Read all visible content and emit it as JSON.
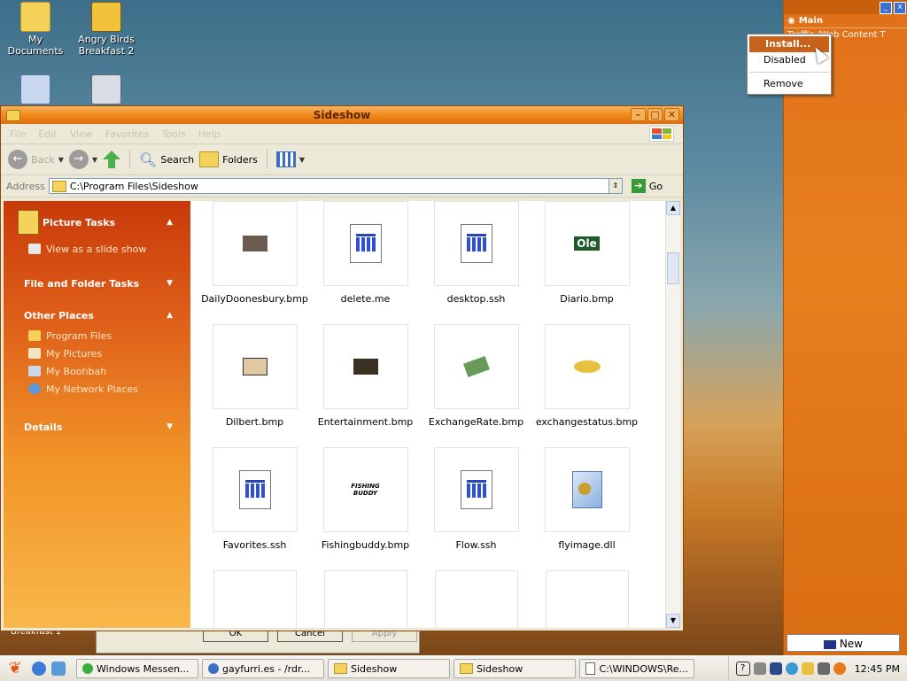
{
  "desktop": {
    "icons": [
      {
        "label": "My Documents"
      },
      {
        "label": "Angry Birds Breakfast 2"
      }
    ]
  },
  "sidebar_gadget": {
    "main_label": "Main",
    "row2_text": "Traffic /Web Content T",
    "new_button": "New"
  },
  "context_menu": {
    "items": [
      "Install...",
      "Disabled",
      "Remove"
    ],
    "selected": "Install..."
  },
  "window": {
    "title": "Sideshow",
    "menu": [
      "File",
      "Edit",
      "View",
      "Favorites",
      "Tools",
      "Help"
    ],
    "toolbar": {
      "back": "Back",
      "search": "Search",
      "folders": "Folders"
    },
    "address_label": "Address",
    "address_value": "C:\\Program Files\\Sideshow",
    "go_label": "Go",
    "tasks": {
      "picture_tasks": "Picture Tasks",
      "picture_items": [
        "View as a slide show"
      ],
      "file_folder_tasks": "File and Folder Tasks",
      "other_places": "Other Places",
      "other_items": [
        "Program Files",
        "My Pictures",
        "My Boohbah",
        "My Network Places"
      ],
      "details": "Details"
    },
    "files": [
      {
        "name": "DailyDoonesbury.bmp"
      },
      {
        "name": "delete.me"
      },
      {
        "name": "desktop.ssh"
      },
      {
        "name": "Diario.bmp"
      },
      {
        "name": "Dilbert.bmp"
      },
      {
        "name": "Entertainment.bmp"
      },
      {
        "name": "ExchangeRate.bmp"
      },
      {
        "name": "exchangestatus.bmp"
      },
      {
        "name": "Favorites.ssh"
      },
      {
        "name": "Fishingbuddy.bmp"
      },
      {
        "name": "Flow.ssh"
      },
      {
        "name": "flyimage.dll"
      },
      {
        "name": ""
      },
      {
        "name": ""
      },
      {
        "name": ""
      },
      {
        "name": ""
      }
    ],
    "thumb_texts": {
      "diario": "Ole",
      "fishing": "FISHING BUDDY"
    }
  },
  "behind_dialog": {
    "buttons": [
      "OK",
      "Cancel",
      "Apply"
    ],
    "label": "Breakfast 1"
  },
  "taskbar": {
    "tasks": [
      "Windows Messen...",
      "gayfurri.es - /rdr...",
      "Sideshow",
      "Sideshow",
      "C:\\WINDOWS\\Re..."
    ],
    "clock": "12:45 PM"
  }
}
